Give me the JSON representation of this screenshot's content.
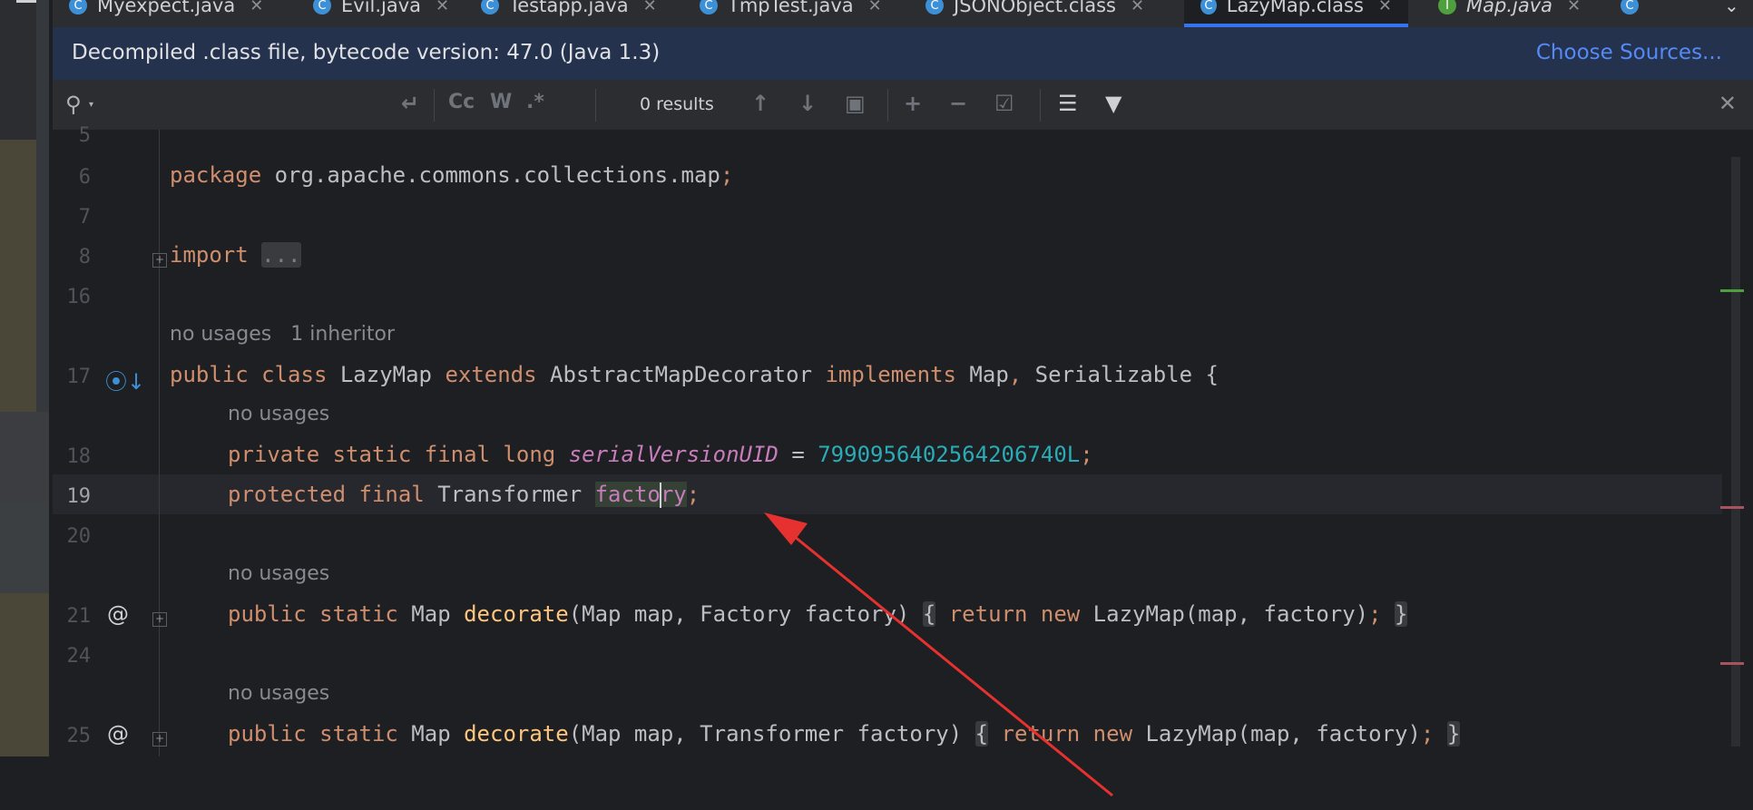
{
  "tabs": [
    {
      "label": "Myexpect.java",
      "icon": "java-class-icon"
    },
    {
      "label": "Evil.java",
      "icon": "java-class-icon"
    },
    {
      "label": "Testapp.java",
      "icon": "java-class-icon"
    },
    {
      "label": "TmpTest.java",
      "icon": "java-class-icon"
    },
    {
      "label": "JSONObject.class",
      "icon": "java-class-icon"
    },
    {
      "label": "LazyMap.class",
      "icon": "java-class-icon",
      "active": true
    },
    {
      "label": "Map.java",
      "icon": "interface-icon"
    }
  ],
  "banner": {
    "message": "Decompiled .class file, bytecode version: 47.0 (Java 1.3)",
    "link": "Choose Sources..."
  },
  "search": {
    "placeholder": "",
    "results": "0 results"
  },
  "editor": {
    "line_numbers": [
      "5",
      "6",
      "7",
      "8",
      "16",
      "17",
      "18",
      "19",
      "20",
      "21",
      "24",
      "25"
    ],
    "current_line": "19",
    "hints": {
      "class_usages": "no usages",
      "class_inheritors": "1 inheritor",
      "field_usages": "no usages",
      "decorate1_usages": "no usages",
      "decorate2_usages": "no usages"
    },
    "code": {
      "l6_kw": "package",
      "l6_rest": " org.apache.commons.collections.map",
      "l6_semi": ";",
      "l8_kw": "import",
      "l8_fold": "...",
      "l17_kw1": "public class",
      "l17_name": " LazyMap ",
      "l17_kw2": "extends",
      "l17_super": " AbstractMapDecorator ",
      "l17_kw3": "implements",
      "l17_ifaces": " Map",
      "l17_comma": ",",
      "l17_ifaces2": " Serializable {",
      "l18_kw": "private static final long",
      "l18_field": "serialVersionUID",
      "l18_eq": " = ",
      "l18_num": "7990956402564206740L",
      "l18_semi": ";",
      "l19_kw": "protected final",
      "l19_type": " Transformer ",
      "l19_field_a": "facto",
      "l19_field_b": "ry",
      "l19_semi": ";",
      "l21_kw": "public static",
      "l21_type": " Map ",
      "l21_fn": "decorate",
      "l21_params": "(Map map, Factory factory)",
      "l21_lbrace": "{",
      "l21_ret": " return new",
      "l21_call": " LazyMap(map, factory)",
      "l21_semi": ";",
      "l21_rbrace": "}",
      "l25_kw": "public static",
      "l25_type": " Map ",
      "l25_fn": "decorate",
      "l25_params": "(Map map, Transformer factory)",
      "l25_lbrace": "{",
      "l25_ret": " return new",
      "l25_call": " LazyMap(map, factory)",
      "l25_semi": ";",
      "l25_rbrace": "}"
    }
  },
  "colors": {
    "keyword": "#cf8e6d",
    "number": "#2aacb8",
    "field": "#c77dbb",
    "method_decl": "#fec57d",
    "annotation_arrow": "#e5312f"
  }
}
